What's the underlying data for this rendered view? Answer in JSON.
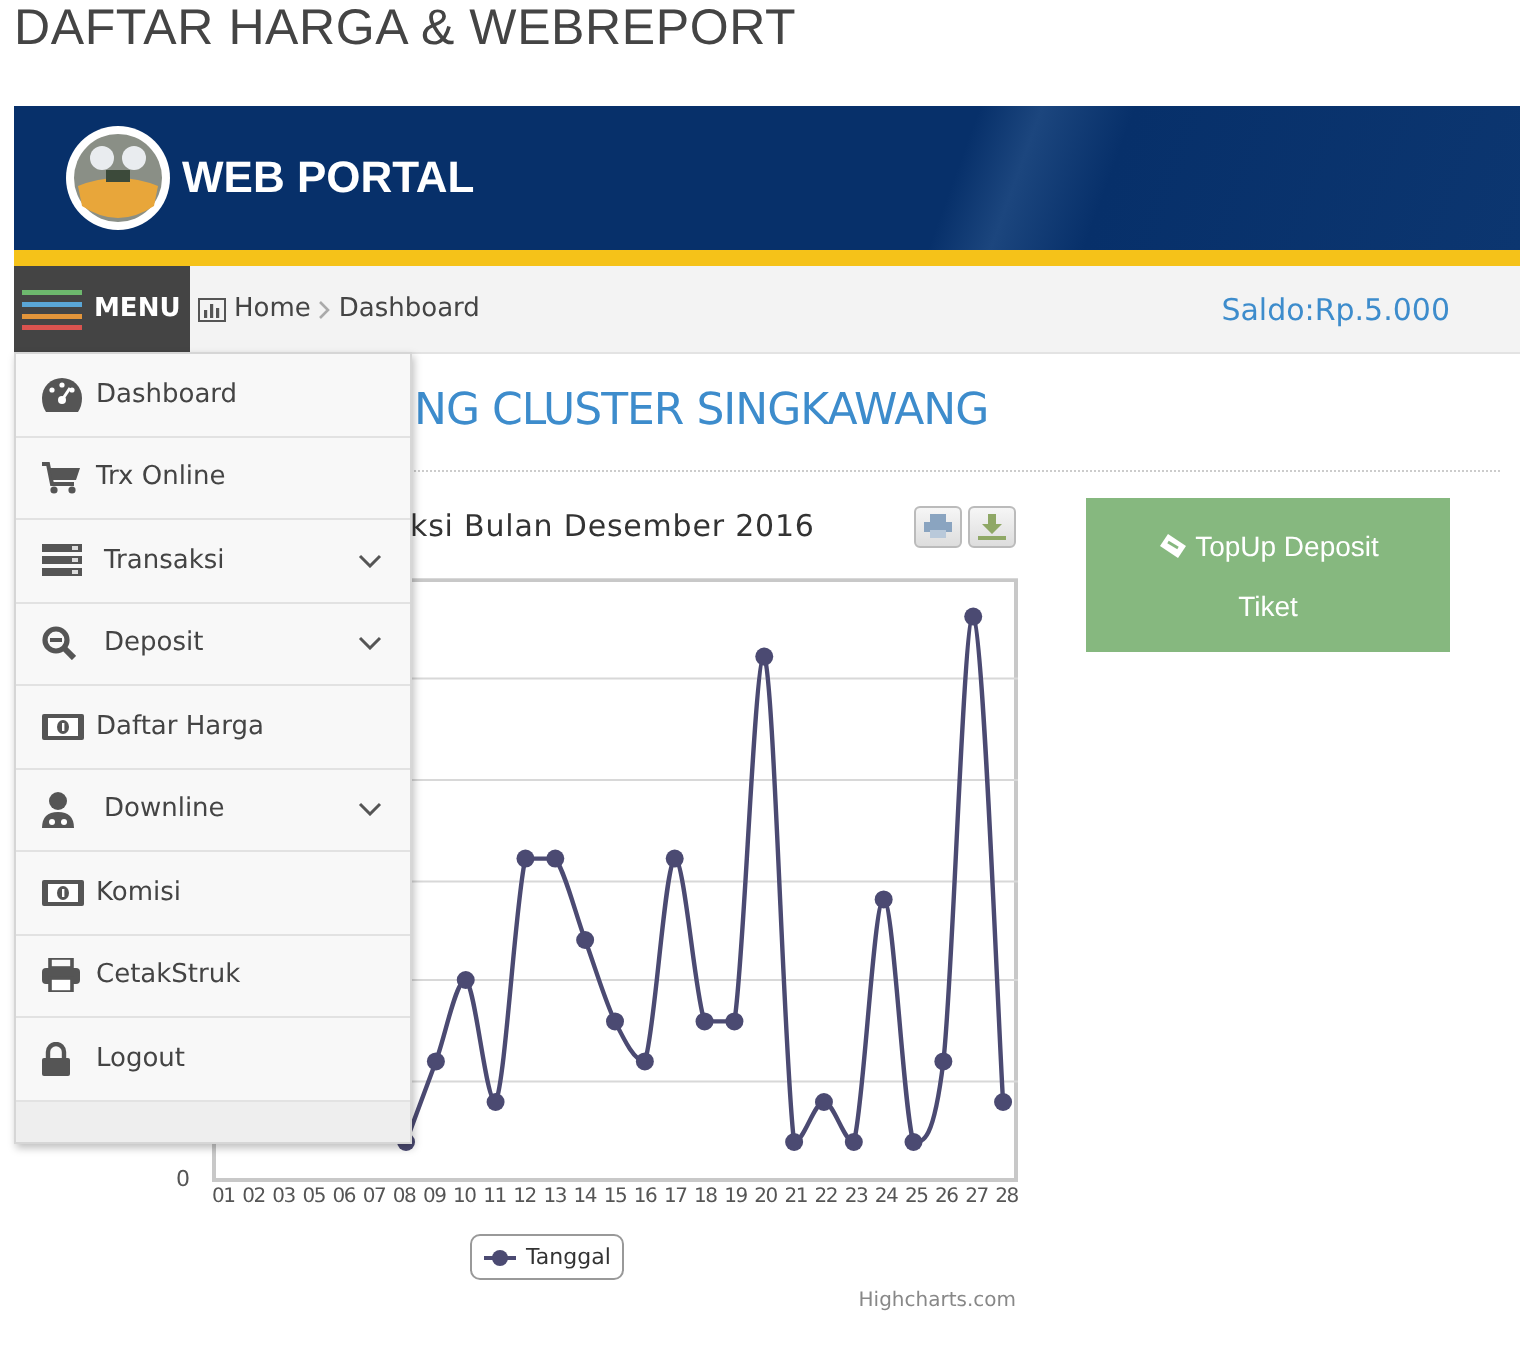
{
  "page_title": "DAFTAR HARGA & WEBREPORT",
  "header": {
    "brand": "WEB PORTAL"
  },
  "toolbar": {
    "menu_button": "MENU",
    "breadcrumb": [
      "Home",
      "Dashboard"
    ],
    "balance": "Saldo:Rp.5.000"
  },
  "menu": {
    "items": [
      {
        "label": "Dashboard",
        "kind": "link"
      },
      {
        "label": "Trx Online",
        "kind": "link"
      },
      {
        "label": "Transaksi",
        "kind": "submenu"
      },
      {
        "label": "Deposit",
        "kind": "submenu"
      },
      {
        "label": "Daftar Harga",
        "kind": "link"
      },
      {
        "label": "Downline",
        "kind": "submenu"
      },
      {
        "label": "Komisi",
        "kind": "link"
      },
      {
        "label": "CetakStruk",
        "kind": "link"
      },
      {
        "label": "Logout",
        "kind": "link"
      }
    ]
  },
  "heading": "NG CLUSTER SINGKAWANG",
  "chart": {
    "title": "ksi Bulan Desember 2016",
    "y_tick": "0",
    "x_labels": [
      "01",
      "02",
      "03",
      "05",
      "06",
      "07",
      "08",
      "09",
      "10",
      "11",
      "12",
      "13",
      "14",
      "15",
      "16",
      "17",
      "18",
      "19",
      "20",
      "21",
      "22",
      "23",
      "24",
      "25",
      "26",
      "27",
      "28"
    ],
    "legend": "Tanggal",
    "credit": "Highcharts.com"
  },
  "topup_button": {
    "line_1": "TopUp Deposit",
    "line_2": "Tiket"
  }
}
